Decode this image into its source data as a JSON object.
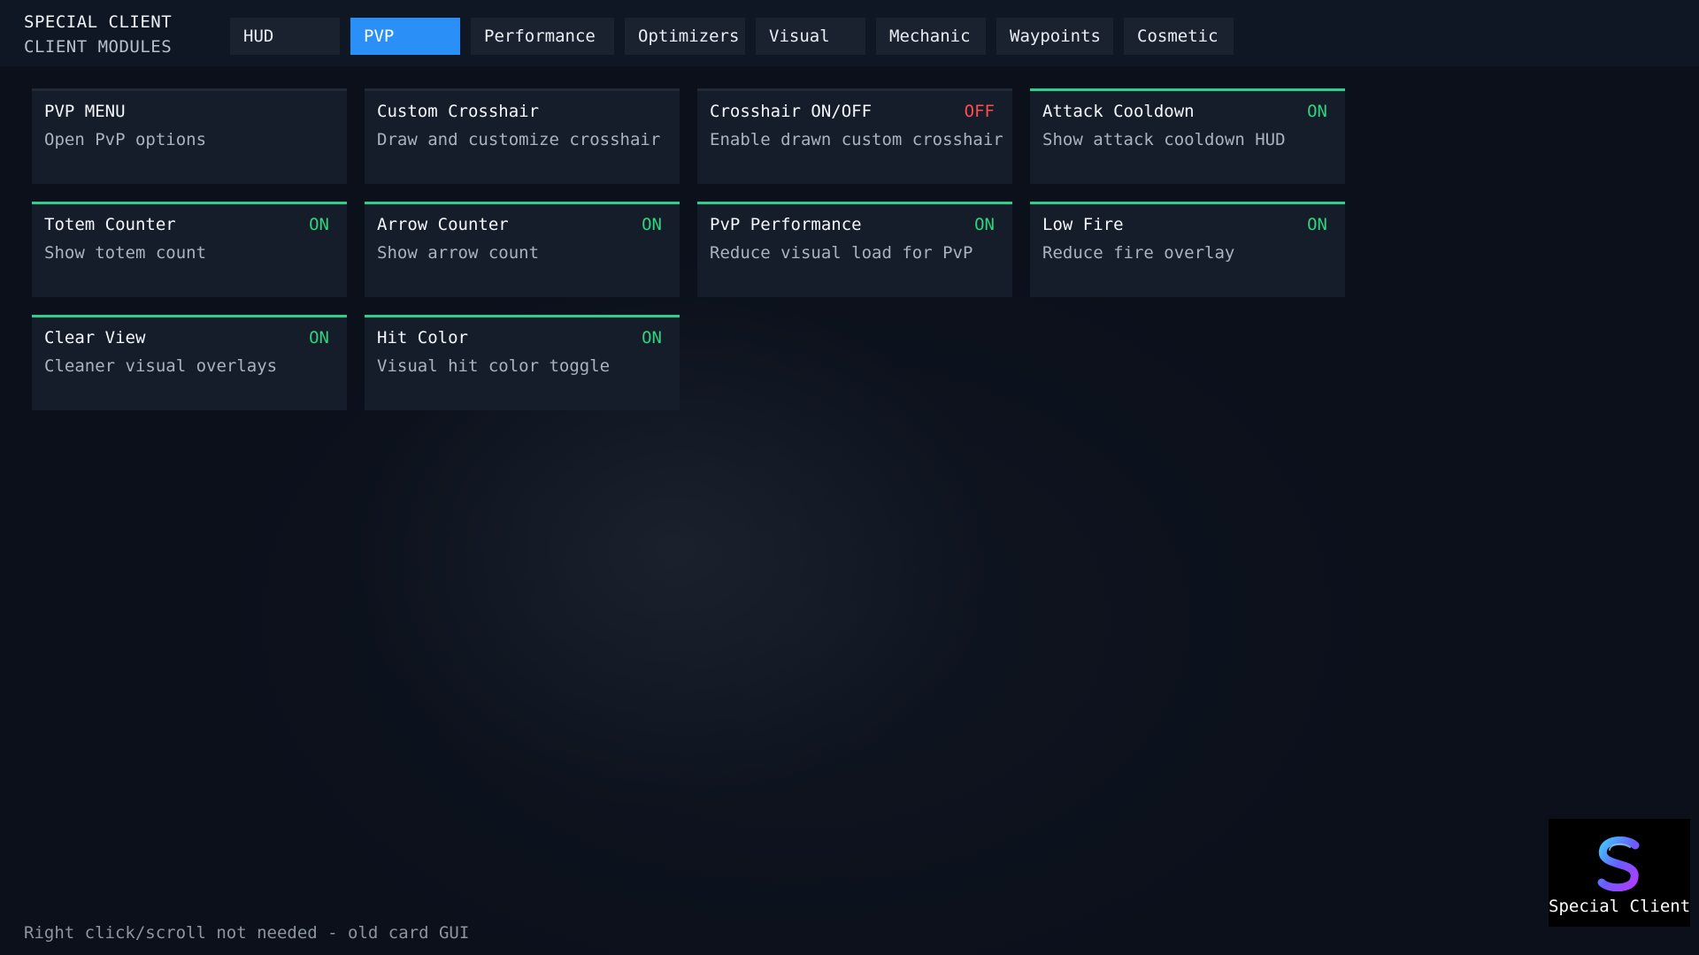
{
  "brand": {
    "title": "SPECIAL CLIENT",
    "subtitle": "CLIENT MODULES"
  },
  "tabs": [
    {
      "label": "HUD",
      "active": false
    },
    {
      "label": "PVP",
      "active": true
    },
    {
      "label": "Performance",
      "active": false
    },
    {
      "label": "Optimizers",
      "active": false
    },
    {
      "label": "Visual",
      "active": false
    },
    {
      "label": "Mechanic",
      "active": false
    },
    {
      "label": "Waypoints",
      "active": false
    },
    {
      "label": "Cosmetic",
      "active": false
    }
  ],
  "modules": [
    {
      "name": "PVP MENU",
      "desc": "Open PvP options",
      "status": ""
    },
    {
      "name": "Custom Crosshair",
      "desc": "Draw and customize crosshair",
      "status": ""
    },
    {
      "name": "Crosshair ON/OFF",
      "desc": "Enable drawn custom crosshair",
      "status": "OFF"
    },
    {
      "name": "Attack Cooldown",
      "desc": "Show attack cooldown HUD",
      "status": "ON"
    },
    {
      "name": "Totem Counter",
      "desc": "Show totem count",
      "status": "ON"
    },
    {
      "name": "Arrow Counter",
      "desc": "Show arrow count",
      "status": "ON"
    },
    {
      "name": "PvP Performance",
      "desc": "Reduce visual load for PvP",
      "status": "ON"
    },
    {
      "name": "Low Fire",
      "desc": "Reduce fire overlay",
      "status": "ON"
    },
    {
      "name": "Clear View",
      "desc": "Cleaner visual overlays",
      "status": "ON"
    },
    {
      "name": "Hit Color",
      "desc": "Visual hit color toggle",
      "status": "ON"
    }
  ],
  "footer": {
    "hint": "Right click/scroll not needed - old card GUI"
  },
  "logo": {
    "icon": "s-logo-icon",
    "text": "Special Client"
  },
  "colors": {
    "accent": "#2a8ff7",
    "on": "#2ed37f",
    "off": "#ff4d4d",
    "on_bar": "#2ecf8a"
  }
}
